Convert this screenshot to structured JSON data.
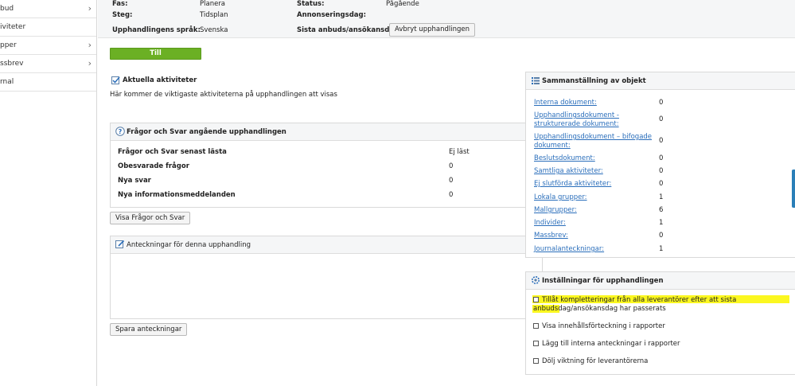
{
  "sidebar": {
    "items": [
      {
        "label": "bud",
        "chevron": true
      },
      {
        "label": "iviteter",
        "chevron": false
      },
      {
        "label": "pper",
        "chevron": true
      },
      {
        "label": "ssbrev",
        "chevron": true
      },
      {
        "label": "rnal",
        "chevron": false
      }
    ]
  },
  "header": {
    "fas_label": "Fas:",
    "fas_value": "Planera",
    "status_label": "Status:",
    "status_value": "Pågående",
    "steg_label": "Steg:",
    "steg_value": "Tidsplan",
    "annons_label": "Annonseringsdag:",
    "sprak_label": "Upphandlingens språk:",
    "sprak_value": "Svenska",
    "sista_label": "Sista anbuds/ansökansdag:",
    "abort_button": "Avbryt upphandlingen"
  },
  "process_button": "Till upphandlingsprocessen",
  "activities": {
    "title": "Aktuella aktiviteter",
    "text": "Här kommer de viktigaste aktiviteterna på upphandlingen att visas"
  },
  "qa": {
    "title": "Frågor och Svar angående upphandlingen",
    "rows": [
      {
        "label": "Frågor och Svar senast lästa",
        "value": "Ej läst"
      },
      {
        "label": "Obesvarade frågor",
        "value": "0"
      },
      {
        "label": "Nya svar",
        "value": "0"
      },
      {
        "label": "Nya informationsmeddelanden",
        "value": "0"
      }
    ],
    "button": "Visa Frågor och Svar"
  },
  "notes": {
    "title": "Anteckningar för denna upphandling",
    "value": "",
    "button": "Spara anteckningar"
  },
  "summary": {
    "title": "Sammanställning av objekt",
    "items": [
      {
        "label": "Interna dokument:",
        "value": "0"
      },
      {
        "label": "Upphandlingsdokument - strukturerade dokument:",
        "value": "0"
      },
      {
        "label": "Upphandlingsdokument – bifogade dokument:",
        "value": "0"
      },
      {
        "label": "Beslutsdokument:",
        "value": "0"
      },
      {
        "label": "Samtliga aktiviteter:",
        "value": "0"
      },
      {
        "label": "Ej slutförda aktiviteter:",
        "value": "0"
      },
      {
        "label": "Lokala grupper:",
        "value": "1"
      },
      {
        "label": "Mallgrupper:",
        "value": "6"
      },
      {
        "label": "Individer:",
        "value": "1"
      },
      {
        "label": "Massbrev:",
        "value": "0"
      },
      {
        "label": "Journalanteckningar:",
        "value": "1"
      }
    ]
  },
  "settings": {
    "title": "Inställningar för upphandlingen",
    "options": [
      {
        "label": "Tillåt kompletteringar från alla leverantörer efter att sista anbudsdag/ansökansdag har passerats",
        "checked": false
      },
      {
        "label": "Visa innehållsförteckning i rapporter",
        "checked": false
      },
      {
        "label": "Lägg till interna anteckningar i rapporter",
        "checked": false
      },
      {
        "label": "Dölj viktning för leverantörerna",
        "checked": false
      }
    ]
  },
  "colors": {
    "accent_green": "#6bb024",
    "link_blue": "#2a6ebb",
    "highlight_yellow": "#fbf720",
    "edge_tab_blue": "#2a7fb8"
  }
}
